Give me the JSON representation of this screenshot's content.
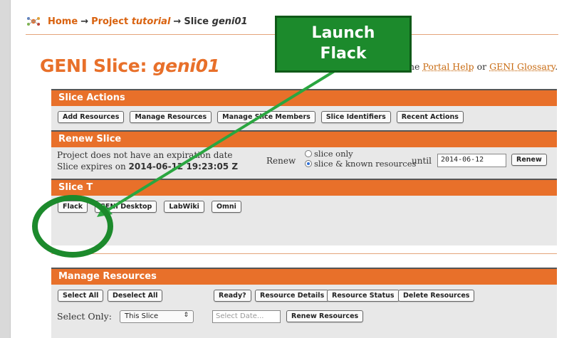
{
  "breadcrumb": {
    "home": "Home",
    "arrow": "→",
    "project_prefix": "Project",
    "project_name": "tutorial",
    "slice_prefix": "Slice",
    "slice_name": "geni01"
  },
  "title": {
    "prefix": "GENI Slice:",
    "name": "geni01"
  },
  "help": {
    "suffix": "he",
    "portal_help": "Portal Help",
    "or": "or",
    "glossary": "GENI Glossary",
    "period": "."
  },
  "slice_actions": {
    "heading": "Slice Actions",
    "buttons": [
      "Add Resources",
      "Manage Resources",
      "Manage Slice Members",
      "Slice Identifiers",
      "Recent Actions"
    ]
  },
  "renew": {
    "heading": "Renew Slice",
    "line1": "Project does not have an expiration date",
    "line2_prefix": "Slice expires on",
    "expires": "2014-06-12 19:23:05 Z",
    "renew_label": "Renew",
    "option_slice_only": "slice only",
    "option_slice_known": "slice & known resources",
    "until": "until",
    "date_value": "2014-06-12",
    "button": "Renew"
  },
  "tools": {
    "heading": "Slice T",
    "buttons": [
      "Flack",
      "GENI Desktop",
      "LabWiki",
      "Omni"
    ]
  },
  "manage": {
    "heading": "Manage Resources",
    "buttons_left": [
      "Select All",
      "Deselect All"
    ],
    "buttons_right": [
      "Ready?",
      "Resource Details",
      "Resource Status",
      "Delete Resources"
    ],
    "select_only_label": "Select Only:",
    "select_value": "This Slice",
    "date_placeholder": "Select Date...",
    "renew_resources": "Renew Resources"
  },
  "callout": {
    "line1": "Launch",
    "line2": "Flack"
  },
  "colors": {
    "accent": "#e8702a",
    "callout": "#1c8a2c",
    "callout_border": "#0f5a18",
    "arrow": "#2aa640"
  },
  "icons": {
    "logo": "geni-logo-icon",
    "select_caret": "updown-caret-icon"
  }
}
